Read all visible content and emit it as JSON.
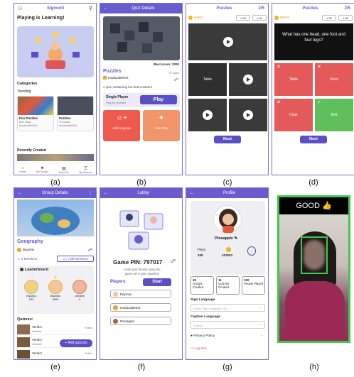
{
  "captions": [
    "(a)",
    "(b)",
    "(c)",
    "(d)",
    "(e)",
    "(f)",
    "(g)",
    "(h)"
  ],
  "a": {
    "app_title": "Signooti",
    "headline": "Playing is Learning!",
    "categories": "Categories",
    "trending": "Trending",
    "items": [
      {
        "title": "Fun Puzzles",
        "plays": "600 plays",
        "author": "ImplacableEnt"
      },
      {
        "title": "Puzzles",
        "plays": "70 plays",
        "author": "ImplacableEnt"
      }
    ],
    "recently": "Recently Created",
    "nav": [
      "Home",
      "My Groups",
      "Enter Pin",
      "My Quizzes"
    ]
  },
  "b": {
    "title": "Quiz Details",
    "best_score": "Best score: 2200",
    "name": "Puzzles",
    "plays": "70 plays",
    "author": "ImplacableEnt",
    "desc": "A quiz containing fun brain-teasers",
    "single": "Single Player",
    "single_sub": "Play by yourself",
    "play": "Play",
    "add_group": "Add to group",
    "live": "Live Play"
  },
  "c": {
    "title": "Puzzles",
    "progress": "2/5",
    "coins": "84803",
    "x50": "x 50",
    "x64": "x 64",
    "answers": [
      "Table",
      "",
      "",
      ""
    ],
    "next": "Next"
  },
  "d": {
    "title": "Puzzles",
    "progress": "2/5",
    "coins": "85033",
    "x50": "x 50",
    "x65": "x 65",
    "question": "What has one head, one foot and four legs?",
    "answers": [
      "Table",
      "Stool",
      "Chair",
      "Bed"
    ],
    "next": "Next"
  },
  "e": {
    "title": "Group Details",
    "name": "Geography",
    "owner": "Baymax",
    "members": "3 Members",
    "add_members": "Add Members",
    "leaderboard": "Leaderboard",
    "leaders": [
      {
        "name": "Implaca",
        "score": "202"
      },
      {
        "name": "Baymax",
        "score": "3000"
      },
      {
        "name": "Ultrable",
        "score": "0"
      }
    ],
    "quizzes": "Quizzes:",
    "quiz_rows": [
      {
        "title": "Verdict",
        "sub": "Ultrable",
        "tag": "Public"
      },
      {
        "title": "Verdict",
        "sub": "Ultrable",
        "tag": "Public"
      },
      {
        "title": "Verdict",
        "sub": "",
        "tag": "Public"
      }
    ],
    "add_quizzes": "+ Add quizzes"
  },
  "f": {
    "title": "Lobby",
    "pin": "Game PIN: 797017",
    "invite": "Invite your friends using the game pin to play together!",
    "players": "Players",
    "start": "Start",
    "list": [
      "Baymax",
      "ImplacableEnt",
      "Pineapple"
    ]
  },
  "g": {
    "title": "Profile",
    "name": "Pineapple",
    "plays_label": "Plays",
    "plays": "349",
    "coins": "107603",
    "stats": [
      {
        "n": "35",
        "l": "Groups Created"
      },
      {
        "n": "11",
        "l": "Quizzes Created"
      },
      {
        "n": "330",
        "l": "People Played"
      }
    ],
    "sign_lang": "Sign Language",
    "sign_val": "Indian Sign Language (ISL)",
    "cap_lang": "Caption Language",
    "cap_val": "English",
    "privacy": "Privacy Policy",
    "logout": "Log Out"
  },
  "h": {
    "banner": "GOOD 👍"
  }
}
